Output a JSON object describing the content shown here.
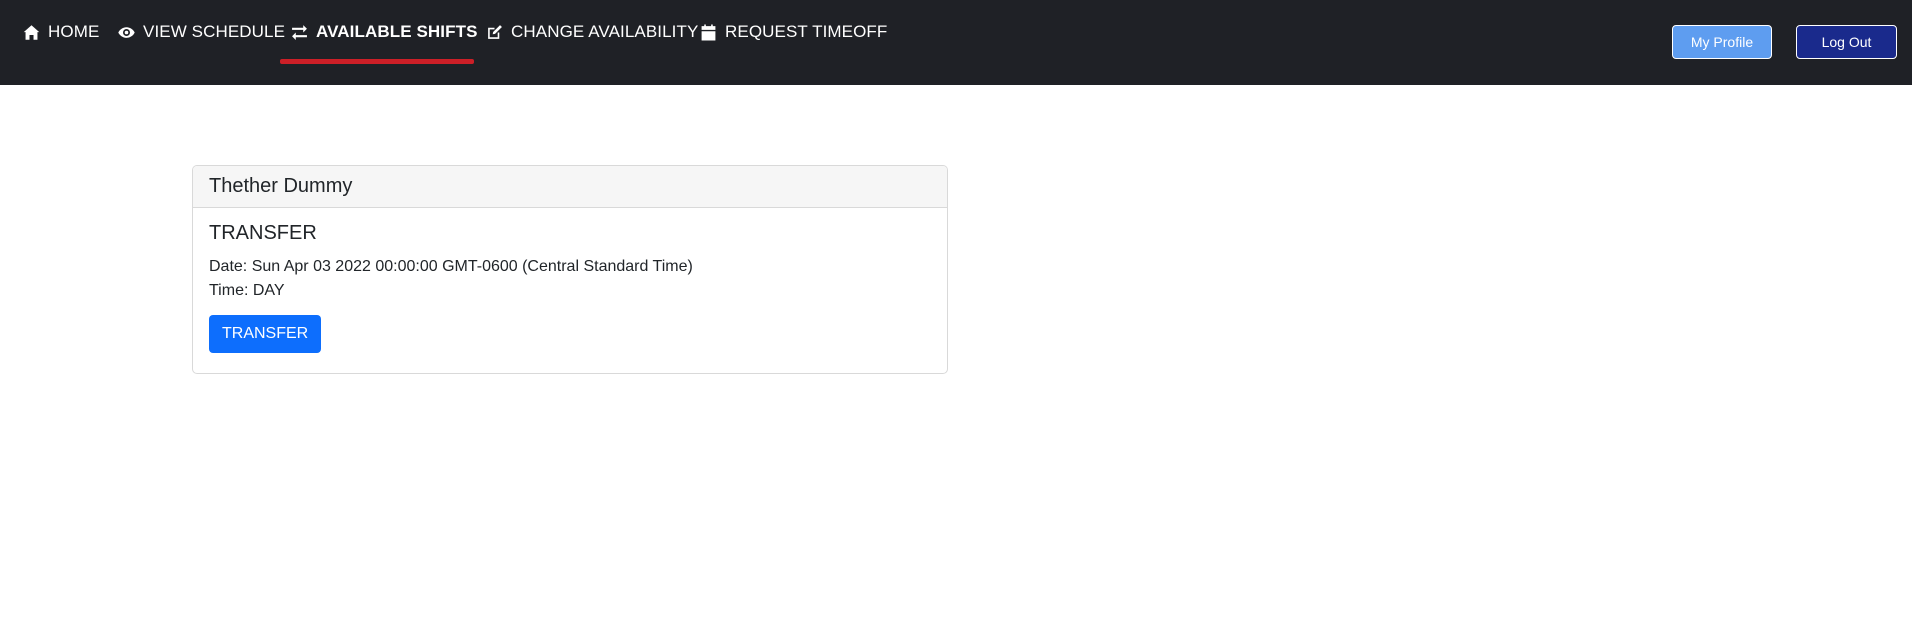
{
  "nav": {
    "items": [
      {
        "label": "HOME",
        "icon": "home-icon"
      },
      {
        "label": "VIEW SCHEDULE",
        "icon": "eye-icon"
      },
      {
        "label": "AVAILABLE SHIFTS",
        "icon": "swap-arrows-icon",
        "active": true
      },
      {
        "label": "CHANGE AVAILABILITY",
        "icon": "edit-icon"
      },
      {
        "label": "REQUEST TIMEOFF",
        "icon": "calendar-icon"
      }
    ],
    "active_underline_color": "#cc1f27",
    "background": "#1f2126"
  },
  "header_buttons": {
    "profile_label": "My Profile",
    "logout_label": "Log Out"
  },
  "shift_card": {
    "header": "Thether Dummy",
    "title": "TRANSFER",
    "date_line": "Date: Sun Apr 03 2022 00:00:00 GMT-0600 (Central Standard Time)",
    "time_line": "Time: DAY",
    "button_label": "TRANSFER"
  },
  "colors": {
    "primary": "#0d6efd",
    "profile_button": "#5e9df0",
    "logout_button": "#1a2a8c"
  }
}
